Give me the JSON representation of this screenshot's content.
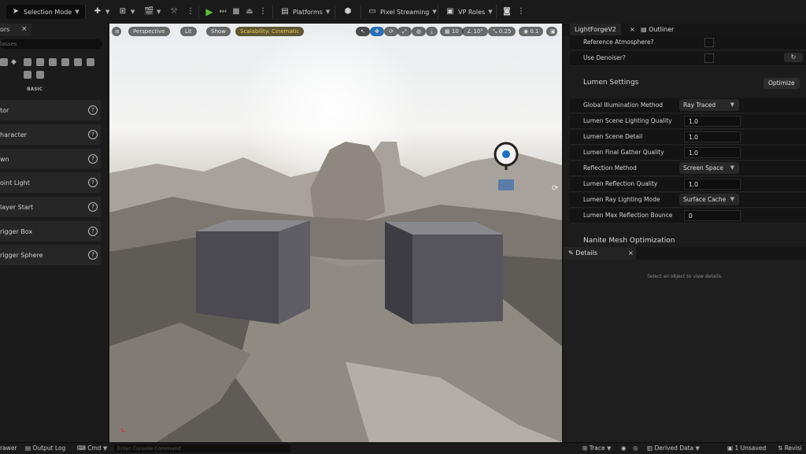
{
  "toolbar": {
    "selection_mode": "Selection Mode",
    "platforms": "Platforms",
    "pixel_streaming": "Pixel Streaming",
    "vp_roles": "VP Roles"
  },
  "left_panel": {
    "tab_label": "ors",
    "search_placeholder": "lasses",
    "category": "BASIC",
    "items": [
      {
        "label": "tor"
      },
      {
        "label": "haracter"
      },
      {
        "label": "wn"
      },
      {
        "label": "oint Light"
      },
      {
        "label": "layer Start"
      },
      {
        "label": "rigger Box"
      },
      {
        "label": "rigger Sphere"
      }
    ]
  },
  "viewport": {
    "view_mode": "Perspective",
    "lighting": "Lit",
    "show": "Show",
    "scalability": "Scalability: Cinematic",
    "grid_snap": "10",
    "rot_snap": "10°",
    "scale_snap": "0.25",
    "cam_speed": "0.1"
  },
  "right_panel": {
    "tab_main": "LightForgeV2",
    "tab_outliner": "Outliner",
    "rows_top": [
      {
        "label": "Reference Atmosphere?"
      },
      {
        "label": "Use Denoiser?"
      }
    ],
    "lumen_section": "Lumen Settings",
    "optimize_button": "Optimize",
    "lumen_rows": [
      {
        "label": "Global Illumination Method",
        "value": "Ray Traced",
        "type": "dropdown"
      },
      {
        "label": "Lumen Scene Lighting Quality",
        "value": "1.0",
        "type": "number"
      },
      {
        "label": "Lumen Scene Detail",
        "value": "1.0",
        "type": "number"
      },
      {
        "label": "Lumen Final Gather Quality",
        "value": "1.0",
        "type": "number"
      },
      {
        "label": "Reflection Method",
        "value": "Screen Space",
        "type": "dropdown"
      },
      {
        "label": "Lumen Reflection Quality",
        "value": "1.0",
        "type": "number"
      },
      {
        "label": "Lumen Ray Lighting Mode",
        "value": "Surface Cache",
        "type": "dropdown"
      },
      {
        "label": "Lumen Max Reflection Bounce",
        "value": "0",
        "type": "number"
      }
    ],
    "nanite_section": "Nanite Mesh Optimization"
  },
  "details": {
    "tab": "Details",
    "empty_message": "Select an object to view details."
  },
  "bottom_bar": {
    "drawer": "rawer",
    "output_log": "Output Log",
    "cmd": "Cmd",
    "console_placeholder": "Enter Console Command",
    "trace": "Trace",
    "derived_data": "Derived Data",
    "unsaved": "1 Unsaved",
    "revision": "Revisi"
  },
  "colors": {
    "accent_yellow": "#e8c84a",
    "play_green": "#5fbf3a",
    "panel_bg": "#1c1c1c"
  }
}
